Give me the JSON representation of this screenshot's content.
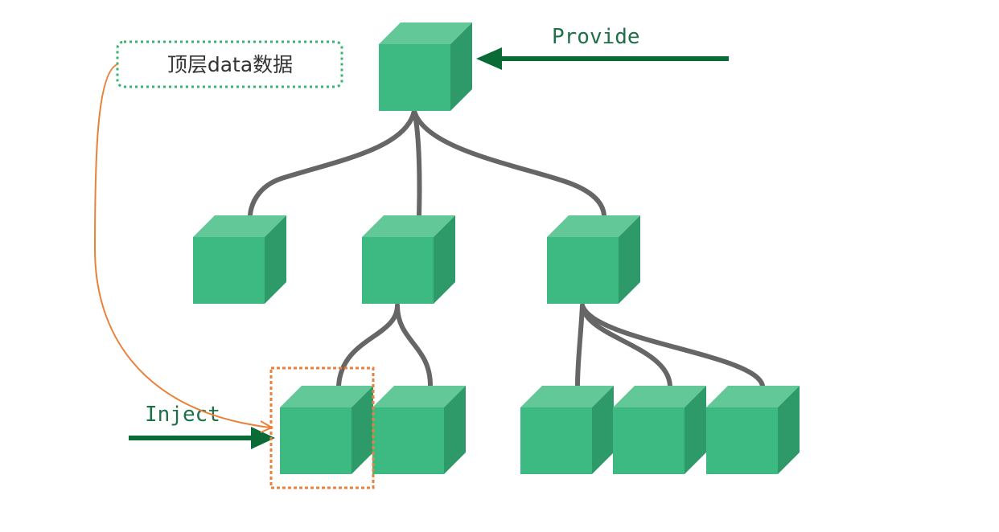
{
  "labels": {
    "provide": "Provide",
    "inject": "Inject",
    "callout": "顶层data数据"
  },
  "colors": {
    "cube_front": "#3dba81",
    "cube_top": "#63c898",
    "cube_side": "#2e9a69",
    "connector": "#666666",
    "arrow": "#0a6b36",
    "label_text": "#1f6f4a",
    "callout_border": "#3bb36e",
    "callout_text": "#333333",
    "curve": "#e8823a",
    "highlight_border": "#e8823a"
  },
  "tree": {
    "root": "top-component",
    "children": {
      "top-component": [
        "child-left",
        "child-middle",
        "child-right"
      ],
      "child-middle": [
        "grandchild-1",
        "grandchild-2"
      ],
      "child-right": [
        "grandchild-3",
        "grandchild-4",
        "grandchild-5"
      ]
    }
  }
}
